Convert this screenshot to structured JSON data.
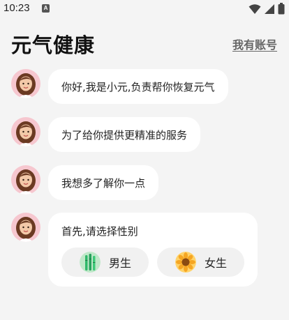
{
  "status_bar": {
    "time": "10:23",
    "notification_badge": "A"
  },
  "header": {
    "title": "元气健康",
    "account_link": "我有账号"
  },
  "messages": [
    {
      "text": "你好,我是小元,负责帮你恢复元气"
    },
    {
      "text": "为了给你提供更精准的服务"
    },
    {
      "text": "我想多了解你一点"
    }
  ],
  "gender_card": {
    "question": "首先,请选择性别",
    "options": [
      {
        "label": "男生",
        "icon": "bamboo-icon",
        "color": "#2fb86a"
      },
      {
        "label": "女生",
        "icon": "sunflower-icon",
        "color": "#f5a623"
      }
    ]
  },
  "colors": {
    "background": "#f4f4f4",
    "bubble": "#ffffff",
    "avatar_bg": "#f6c7cf"
  }
}
